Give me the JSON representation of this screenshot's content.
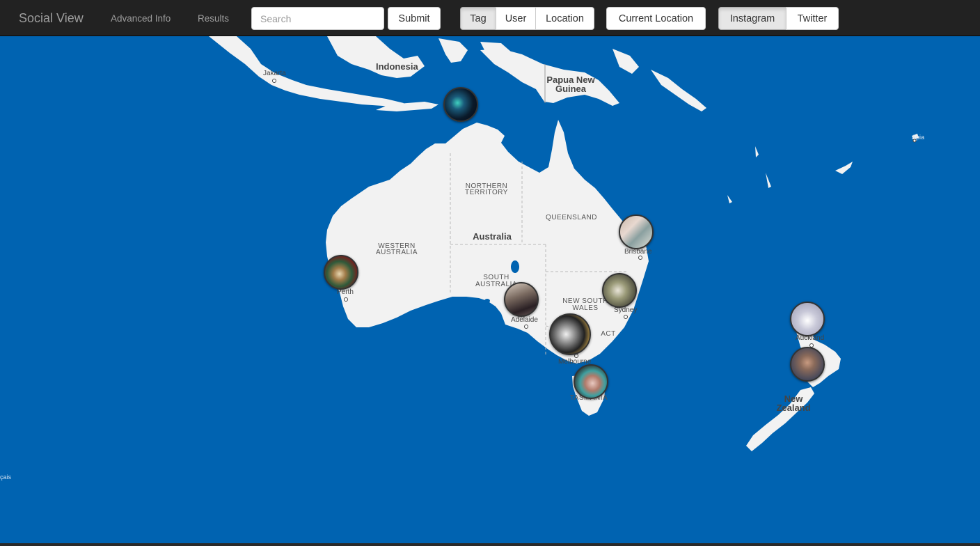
{
  "navbar": {
    "brand": "Social View",
    "links": [
      "Advanced Info",
      "Results"
    ],
    "search": {
      "placeholder": "Search",
      "value": ""
    },
    "submit_label": "Submit",
    "search_type": {
      "options": [
        "Tag",
        "User",
        "Location"
      ],
      "selected": "Tag"
    },
    "current_location_label": "Current Location",
    "source": {
      "options": [
        "Instagram",
        "Twitter"
      ],
      "selected": "Instagram"
    }
  },
  "map": {
    "water_color": "#0063b1",
    "land_color": "#f2f2f2",
    "labels": {
      "indonesia": "Indonesia",
      "jakarta": "Jakarta",
      "png_line1": "Papua New",
      "png_line2": "Guinea",
      "apia": "Apia",
      "northern_territory_1": "NORTHERN",
      "northern_territory_2": "TERRITORY",
      "queensland": "QUEENSLAND",
      "australia": "Australia",
      "western_australia_1": "WESTERN",
      "western_australia_2": "AUSTRALIA",
      "south_australia_1": "SOUTH",
      "south_australia_2": "AUSTRALIA",
      "nsw_1": "NEW SOUTH",
      "nsw_2": "WALES",
      "act": "ACT",
      "brisbane": "Brisbane",
      "sydney": "Sydney",
      "perth": "Perth",
      "adelaide": "Adelaide",
      "melbourne": "Melbourne",
      "tasmania": "TASMANIA",
      "auckland": "Auckland",
      "nz_1": "New",
      "nz_2": "Zealand",
      "left_edge": "çais"
    },
    "markers": [
      {
        "location": "Darwin"
      },
      {
        "location": "Brisbane"
      },
      {
        "location": "Perth"
      },
      {
        "location": "Sydney"
      },
      {
        "location": "Adelaide"
      },
      {
        "location": "Melbourne"
      },
      {
        "location": "Tasmania"
      },
      {
        "location": "Auckland"
      },
      {
        "location": "New Zealand"
      }
    ]
  }
}
